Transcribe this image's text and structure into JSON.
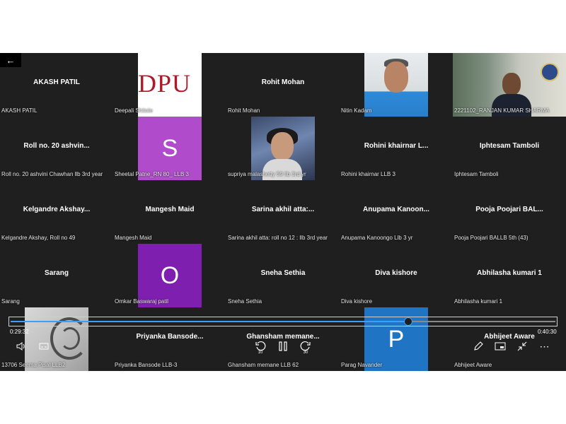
{
  "tiles": [
    {
      "name": "AKASH PATIL",
      "caption": "AKASH PATIL"
    },
    {
      "name": "",
      "caption": "Deepali Shitole",
      "logo": "DPU"
    },
    {
      "name": "Rohit Mohan",
      "caption": "Rohit Mohan"
    },
    {
      "name": "",
      "caption": "Nitin Kadam"
    },
    {
      "name": "",
      "caption": "2221102_RANJAN KUMAR SHARMA"
    },
    {
      "name": "Roll no. 20 ashvin...",
      "caption": "Roll no. 20 ashvini Chawhan llb 3rd year"
    },
    {
      "name": "",
      "caption": "Sheetal Patne_RN 80_ LLB 3",
      "letter": "S"
    },
    {
      "name": "",
      "caption": "supriya malashetty  59 llb 3rd yr"
    },
    {
      "name": "Rohini khairnar L...",
      "caption": "Rohini khairnar LLB 3"
    },
    {
      "name": "Iphtesam Tamboli",
      "caption": "Iphtesam Tamboli"
    },
    {
      "name": "Kelgandre  Akshay...",
      "caption": "Kelgandre Akshay, Roll no 49"
    },
    {
      "name": "Mangesh Maid",
      "caption": "Mangesh Maid"
    },
    {
      "name": "Sarina akhil atta:...",
      "caption": "Sarina akhil atta: roll no 12 : llb 3rd year"
    },
    {
      "name": "Anupama  Kanoon...",
      "caption": "Anupama Kanoongo Llb 3 yr"
    },
    {
      "name": "Pooja Poojari BAL...",
      "caption": "Pooja Poojari BALLB 5th (43)"
    },
    {
      "name": "Sarang",
      "caption": "Sarang"
    },
    {
      "name": "",
      "caption": "Omkar Baswaraj patil",
      "letter": "O"
    },
    {
      "name": "Sneha Sethia",
      "caption": "Sneha Sethia"
    },
    {
      "name": "Diva kishore",
      "caption": "Diva kishore"
    },
    {
      "name": "Abhilasha kumari 1",
      "caption": "Abhilasha kumari 1"
    },
    {
      "name": "",
      "caption": "13706 Seema Pisal LLB2"
    },
    {
      "name": "Priyanka  Bansode...",
      "caption": "Priyanka Bansode LLB-3"
    },
    {
      "name": "Ghansham  memane...",
      "caption": "Ghansham memane LLB 62"
    },
    {
      "name": "",
      "caption": "Parag Navander",
      "letter": "P"
    },
    {
      "name": "Abhijeet Aware",
      "caption": "Abhijeet Aware"
    }
  ],
  "player": {
    "current_time": "0:29:32",
    "total_time": "0:40:30",
    "progress": 0.7293,
    "skip_back": "10",
    "skip_forward": "30"
  },
  "colors": {
    "accent": "#3aa0ff",
    "letter_S": "#b04ccc",
    "letter_O": "#7f1fb0",
    "letter_P": "#1f74c4"
  },
  "icons": [
    "back-arrow-icon",
    "volume-icon",
    "captions-icon",
    "replay-10-icon",
    "pause-icon",
    "forward-30-icon",
    "edit-pen-icon",
    "cast-icon",
    "exit-fullscreen-icon",
    "more-icon"
  ]
}
